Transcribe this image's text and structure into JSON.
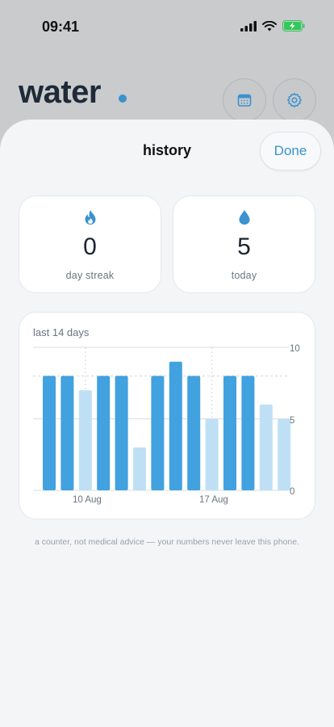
{
  "status_bar": {
    "time": "09:41"
  },
  "background_app": {
    "title": "water"
  },
  "sheet": {
    "title": "history",
    "done_label": "Done"
  },
  "stats": {
    "streak": {
      "value": "0",
      "label": "day streak",
      "icon": "flame-icon"
    },
    "today": {
      "value": "5",
      "label": "today",
      "icon": "water-drop-icon"
    }
  },
  "chart": {
    "title": "last 14 days",
    "x_labels": [
      "10 Aug",
      "17 Aug"
    ],
    "y_labels": [
      "10",
      "5",
      "0"
    ]
  },
  "footer": {
    "note": "a counter, not medical advice — your numbers never leave this phone."
  },
  "colors": {
    "accent": "#3b92cf",
    "bar_goal_met": "#42a1df",
    "bar_goal_missed": "#bfe0f4"
  },
  "chart_data": {
    "type": "bar",
    "title": "last 14 days",
    "categories": [
      "",
      "",
      "10 Aug",
      "",
      "",
      "",
      "",
      "",
      "",
      "17 Aug",
      "",
      "",
      "",
      ""
    ],
    "values": [
      8,
      8,
      7,
      8,
      8,
      3,
      8,
      9,
      8,
      5,
      8,
      8,
      6,
      5
    ],
    "goal": 8,
    "ylim": [
      0,
      10
    ],
    "yticks": [
      0,
      5,
      10
    ],
    "grid": true,
    "axis_position": "right"
  }
}
